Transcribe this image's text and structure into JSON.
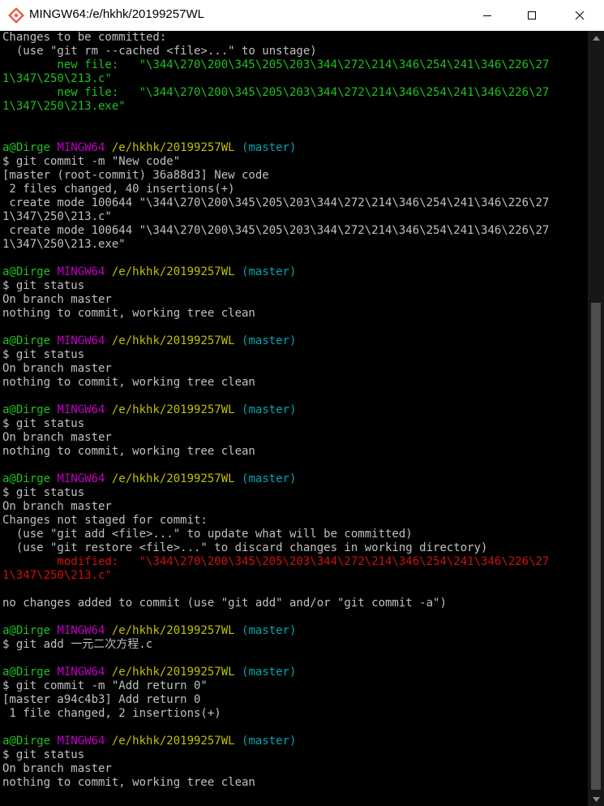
{
  "window": {
    "title": "MINGW64:/e/hkhk/20199257WL",
    "icon": "git-bash-icon",
    "controls": [
      "minimize-icon",
      "maximize-icon",
      "close-icon"
    ]
  },
  "colors": {
    "background": "#000000",
    "text": "#c0c0c0",
    "green": "#20c020",
    "magenta": "#c000c0",
    "yellow": "#c0c000",
    "cyan": "#00a6b2",
    "red": "#d01010"
  },
  "terminal": {
    "lines": [
      [
        {
          "t": "Changes to be committed:"
        }
      ],
      [
        {
          "t": "  (use \"git rm --cached <file>...\" to unstage)"
        }
      ],
      [
        {
          "t": "        new file:   \"\\344\\270\\200\\345\\205\\203\\344\\272\\214\\346\\254\\241\\346\\226\\27",
          "c": "green"
        }
      ],
      [
        {
          "t": "1\\347\\250\\213.c\"",
          "c": "green"
        }
      ],
      [
        {
          "t": "        new file:   \"\\344\\270\\200\\345\\205\\203\\344\\272\\214\\346\\254\\241\\346\\226\\27",
          "c": "green"
        }
      ],
      [
        {
          "t": "1\\347\\250\\213.exe\"",
          "c": "green"
        }
      ],
      [],
      [],
      [
        {
          "t": "a@Dirge ",
          "c": "green"
        },
        {
          "t": "MINGW64 ",
          "c": "magenta"
        },
        {
          "t": "/e/hkhk/20199257WL ",
          "c": "yellow"
        },
        {
          "t": "(master)",
          "c": "cyan"
        }
      ],
      [
        {
          "t": "$ git commit -m \"New code\""
        }
      ],
      [
        {
          "t": "[master (root-commit) 36a88d3] New code"
        }
      ],
      [
        {
          "t": " 2 files changed, 40 insertions(+)"
        }
      ],
      [
        {
          "t": " create mode 100644 \"\\344\\270\\200\\345\\205\\203\\344\\272\\214\\346\\254\\241\\346\\226\\27"
        }
      ],
      [
        {
          "t": "1\\347\\250\\213.c\""
        }
      ],
      [
        {
          "t": " create mode 100644 \"\\344\\270\\200\\345\\205\\203\\344\\272\\214\\346\\254\\241\\346\\226\\27"
        }
      ],
      [
        {
          "t": "1\\347\\250\\213.exe\""
        }
      ],
      [],
      [
        {
          "t": "a@Dirge ",
          "c": "green"
        },
        {
          "t": "MINGW64 ",
          "c": "magenta"
        },
        {
          "t": "/e/hkhk/20199257WL ",
          "c": "yellow"
        },
        {
          "t": "(master)",
          "c": "cyan"
        }
      ],
      [
        {
          "t": "$ git status"
        }
      ],
      [
        {
          "t": "On branch master"
        }
      ],
      [
        {
          "t": "nothing to commit, working tree clean"
        }
      ],
      [],
      [
        {
          "t": "a@Dirge ",
          "c": "green"
        },
        {
          "t": "MINGW64 ",
          "c": "magenta"
        },
        {
          "t": "/e/hkhk/20199257WL ",
          "c": "yellow"
        },
        {
          "t": "(master)",
          "c": "cyan"
        }
      ],
      [
        {
          "t": "$ git status"
        }
      ],
      [
        {
          "t": "On branch master"
        }
      ],
      [
        {
          "t": "nothing to commit, working tree clean"
        }
      ],
      [],
      [
        {
          "t": "a@Dirge ",
          "c": "green"
        },
        {
          "t": "MINGW64 ",
          "c": "magenta"
        },
        {
          "t": "/e/hkhk/20199257WL ",
          "c": "yellow"
        },
        {
          "t": "(master)",
          "c": "cyan"
        }
      ],
      [
        {
          "t": "$ git status"
        }
      ],
      [
        {
          "t": "On branch master"
        }
      ],
      [
        {
          "t": "nothing to commit, working tree clean"
        }
      ],
      [],
      [
        {
          "t": "a@Dirge ",
          "c": "green"
        },
        {
          "t": "MINGW64 ",
          "c": "magenta"
        },
        {
          "t": "/e/hkhk/20199257WL ",
          "c": "yellow"
        },
        {
          "t": "(master)",
          "c": "cyan"
        }
      ],
      [
        {
          "t": "$ git status"
        }
      ],
      [
        {
          "t": "On branch master"
        }
      ],
      [
        {
          "t": "Changes not staged for commit:"
        }
      ],
      [
        {
          "t": "  (use \"git add <file>...\" to update what will be committed)"
        }
      ],
      [
        {
          "t": "  (use \"git restore <file>...\" to discard changes in working directory)"
        }
      ],
      [
        {
          "t": "        modified:   \"\\344\\270\\200\\345\\205\\203\\344\\272\\214\\346\\254\\241\\346\\226\\27",
          "c": "red"
        }
      ],
      [
        {
          "t": "1\\347\\250\\213.c\"",
          "c": "red"
        }
      ],
      [],
      [
        {
          "t": "no changes added to commit (use \"git add\" and/or \"git commit -a\")"
        }
      ],
      [],
      [
        {
          "t": "a@Dirge ",
          "c": "green"
        },
        {
          "t": "MINGW64 ",
          "c": "magenta"
        },
        {
          "t": "/e/hkhk/20199257WL ",
          "c": "yellow"
        },
        {
          "t": "(master)",
          "c": "cyan"
        }
      ],
      [
        {
          "t": "$ git add 一元二次方程.c"
        }
      ],
      [],
      [
        {
          "t": "a@Dirge ",
          "c": "green"
        },
        {
          "t": "MINGW64 ",
          "c": "magenta"
        },
        {
          "t": "/e/hkhk/20199257WL ",
          "c": "yellow"
        },
        {
          "t": "(master)",
          "c": "cyan"
        }
      ],
      [
        {
          "t": "$ git commit -m \"Add return 0\""
        }
      ],
      [
        {
          "t": "[master a94c4b3] Add return 0"
        }
      ],
      [
        {
          "t": " 1 file changed, 2 insertions(+)"
        }
      ],
      [],
      [
        {
          "t": "a@Dirge ",
          "c": "green"
        },
        {
          "t": "MINGW64 ",
          "c": "magenta"
        },
        {
          "t": "/e/hkhk/20199257WL ",
          "c": "yellow"
        },
        {
          "t": "(master)",
          "c": "cyan"
        }
      ],
      [
        {
          "t": "$ git status"
        }
      ],
      [
        {
          "t": "On branch master"
        }
      ],
      [
        {
          "t": "nothing to commit, working tree clean"
        }
      ]
    ]
  }
}
